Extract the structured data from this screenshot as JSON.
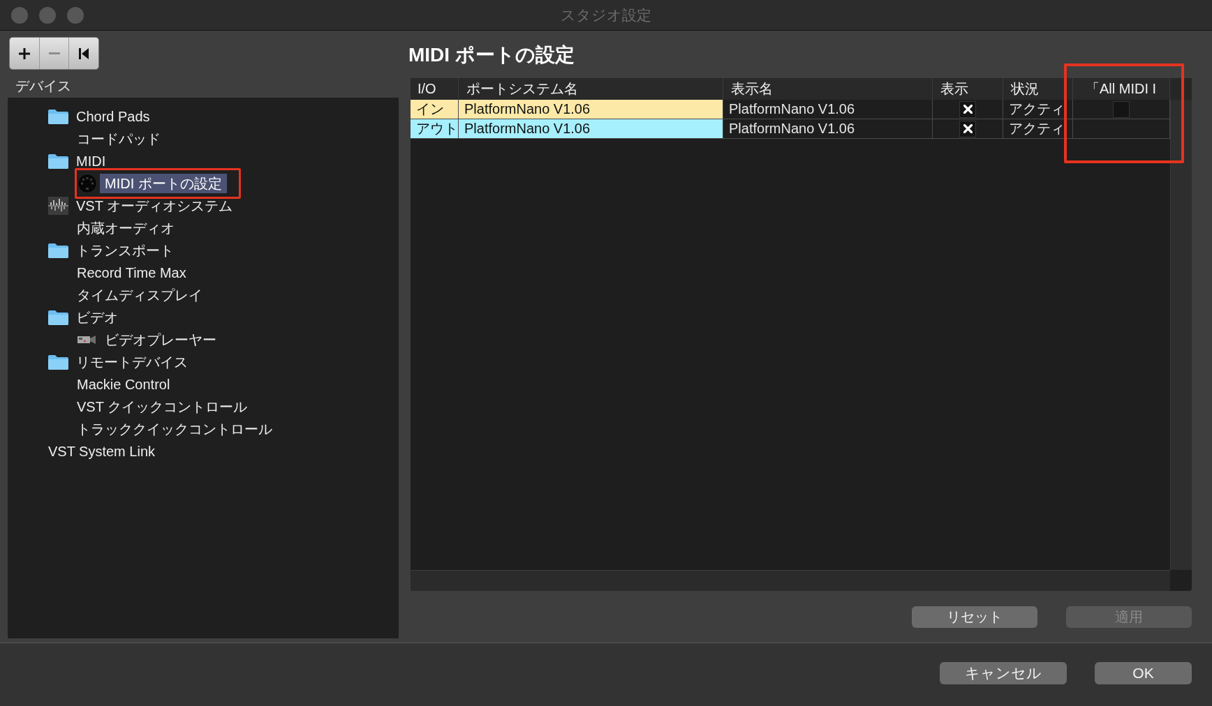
{
  "window": {
    "title": "スタジオ設定"
  },
  "sidebar": {
    "toolbar": [
      {
        "kind": "add",
        "disabled": false
      },
      {
        "kind": "remove",
        "disabled": true
      },
      {
        "kind": "skip-back",
        "disabled": false
      }
    ],
    "label": "デバイス",
    "tree": [
      {
        "label": "Chord Pads",
        "kind": "folder",
        "selected": false,
        "outlined": false,
        "children": [
          {
            "label": "コードパッド",
            "kind": "plain",
            "selected": false,
            "outlined": false
          }
        ]
      },
      {
        "label": "MIDI",
        "kind": "folder",
        "selected": false,
        "outlined": false,
        "children": [
          {
            "label": "MIDI ポートの設定",
            "kind": "midi-port",
            "selected": true,
            "outlined": true
          }
        ]
      },
      {
        "label": "VST オーディオシステム",
        "kind": "audio-system",
        "selected": false,
        "outlined": false,
        "children": [
          {
            "label": "内蔵オーディオ",
            "kind": "plain",
            "selected": false,
            "outlined": false
          }
        ]
      },
      {
        "label": "トランスポート",
        "kind": "folder",
        "selected": false,
        "outlined": false,
        "children": [
          {
            "label": "Record Time Max",
            "kind": "plain",
            "selected": false,
            "outlined": false
          },
          {
            "label": "タイムディスプレイ",
            "kind": "plain",
            "selected": false,
            "outlined": false
          }
        ]
      },
      {
        "label": "ビデオ",
        "kind": "folder",
        "selected": false,
        "outlined": false,
        "children": [
          {
            "label": "ビデオプレーヤー",
            "kind": "video",
            "selected": false,
            "outlined": false
          }
        ]
      },
      {
        "label": "リモートデバイス",
        "kind": "folder",
        "selected": false,
        "outlined": false,
        "children": [
          {
            "label": "Mackie Control",
            "kind": "plain",
            "selected": false,
            "outlined": false
          },
          {
            "label": "VST クイックコントロール",
            "kind": "plain",
            "selected": false,
            "outlined": false
          },
          {
            "label": "トラッククイックコントロール",
            "kind": "plain",
            "selected": false,
            "outlined": false
          }
        ]
      },
      {
        "label": "VST System Link",
        "kind": "plain",
        "selected": false,
        "outlined": false
      }
    ]
  },
  "main": {
    "heading": "MIDI ポートの設定",
    "table": {
      "columns": [
        {
          "label": "I/O",
          "outlined": false
        },
        {
          "label": "ポートシステム名",
          "outlined": false
        },
        {
          "label": "表示名",
          "outlined": false
        },
        {
          "label": "表示",
          "outlined": false
        },
        {
          "label": "状況",
          "outlined": false
        },
        {
          "label": "「All MIDI I",
          "outlined": true
        }
      ],
      "rows": [
        {
          "io": "イン",
          "color": "#fde9a7",
          "port_system_name": "PlatformNano V1.06",
          "display_name": "PlatformNano V1.06",
          "shown": true,
          "status": "アクティ",
          "column_6": {
            "checked": false
          }
        },
        {
          "io": "アウト",
          "color": "#a6effd",
          "port_system_name": "PlatformNano V1.06",
          "display_name": "PlatformNano V1.06",
          "shown": true,
          "status": "アクティ"
        }
      ]
    },
    "buttons": [
      {
        "label": "リセット",
        "disabled": false
      },
      {
        "label": "適用",
        "disabled": true
      }
    ]
  },
  "footer": {
    "buttons": [
      {
        "label": "キャンセル",
        "disabled": false
      },
      {
        "label": "OK",
        "disabled": false
      }
    ]
  }
}
